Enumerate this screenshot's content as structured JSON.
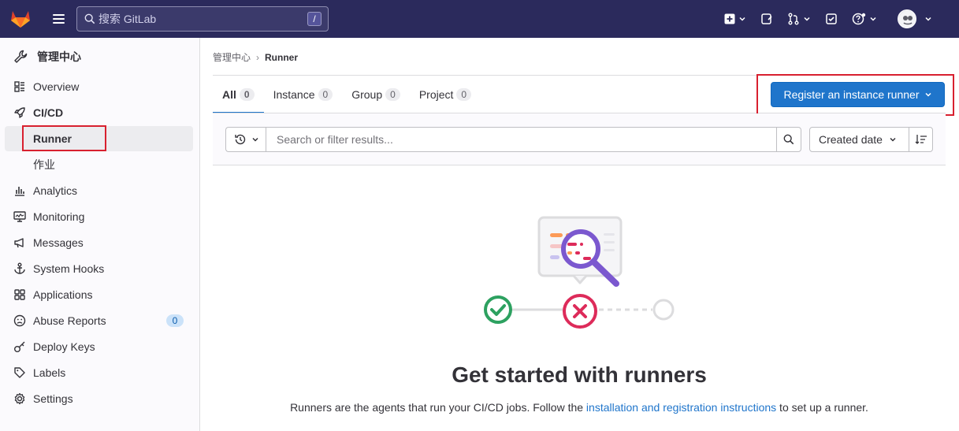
{
  "colors": {
    "topbar": "#2b2a5c",
    "primary": "#1f75cb",
    "highlight_box": "#d8202f",
    "success": "#2da160",
    "danger": "#dd2b5a"
  },
  "topbar": {
    "search_placeholder": "搜索 GitLab",
    "search_shortcut": "/",
    "icons": [
      "create-new-icon",
      "issues-icon",
      "merge-requests-icon",
      "todos-icon",
      "help-icon",
      "user-avatar"
    ]
  },
  "sidebar": {
    "title": "管理中心",
    "items": [
      {
        "label": "Overview",
        "icon": "overview-icon"
      },
      {
        "label": "CI/CD",
        "icon": "rocket-icon"
      },
      {
        "label": "Runner",
        "icon": "",
        "active": true
      },
      {
        "label": "作业",
        "icon": ""
      },
      {
        "label": "Analytics",
        "icon": "chart-icon"
      },
      {
        "label": "Monitoring",
        "icon": "monitor-icon"
      },
      {
        "label": "Messages",
        "icon": "bullhorn-icon"
      },
      {
        "label": "System Hooks",
        "icon": "anchor-icon"
      },
      {
        "label": "Applications",
        "icon": "applications-icon"
      },
      {
        "label": "Abuse Reports",
        "icon": "abuse-icon",
        "badge": "0"
      },
      {
        "label": "Deploy Keys",
        "icon": "key-icon"
      },
      {
        "label": "Labels",
        "icon": "label-icon"
      },
      {
        "label": "Settings",
        "icon": "gear-icon"
      }
    ]
  },
  "breadcrumb": {
    "parent": "管理中心",
    "separator": "›",
    "current": "Runner"
  },
  "tabs": [
    {
      "label": "All",
      "count": "0",
      "active": true
    },
    {
      "label": "Instance",
      "count": "0"
    },
    {
      "label": "Group",
      "count": "0"
    },
    {
      "label": "Project",
      "count": "0"
    }
  ],
  "register_button": "Register an instance runner",
  "filter": {
    "placeholder": "Search or filter results...",
    "sort_label": "Created date"
  },
  "empty_state": {
    "title": "Get started with runners",
    "desc_before": "Runners are the agents that run your CI/CD jobs. Follow the ",
    "link": "installation and registration instructions",
    "desc_after": " to set up a runner."
  }
}
